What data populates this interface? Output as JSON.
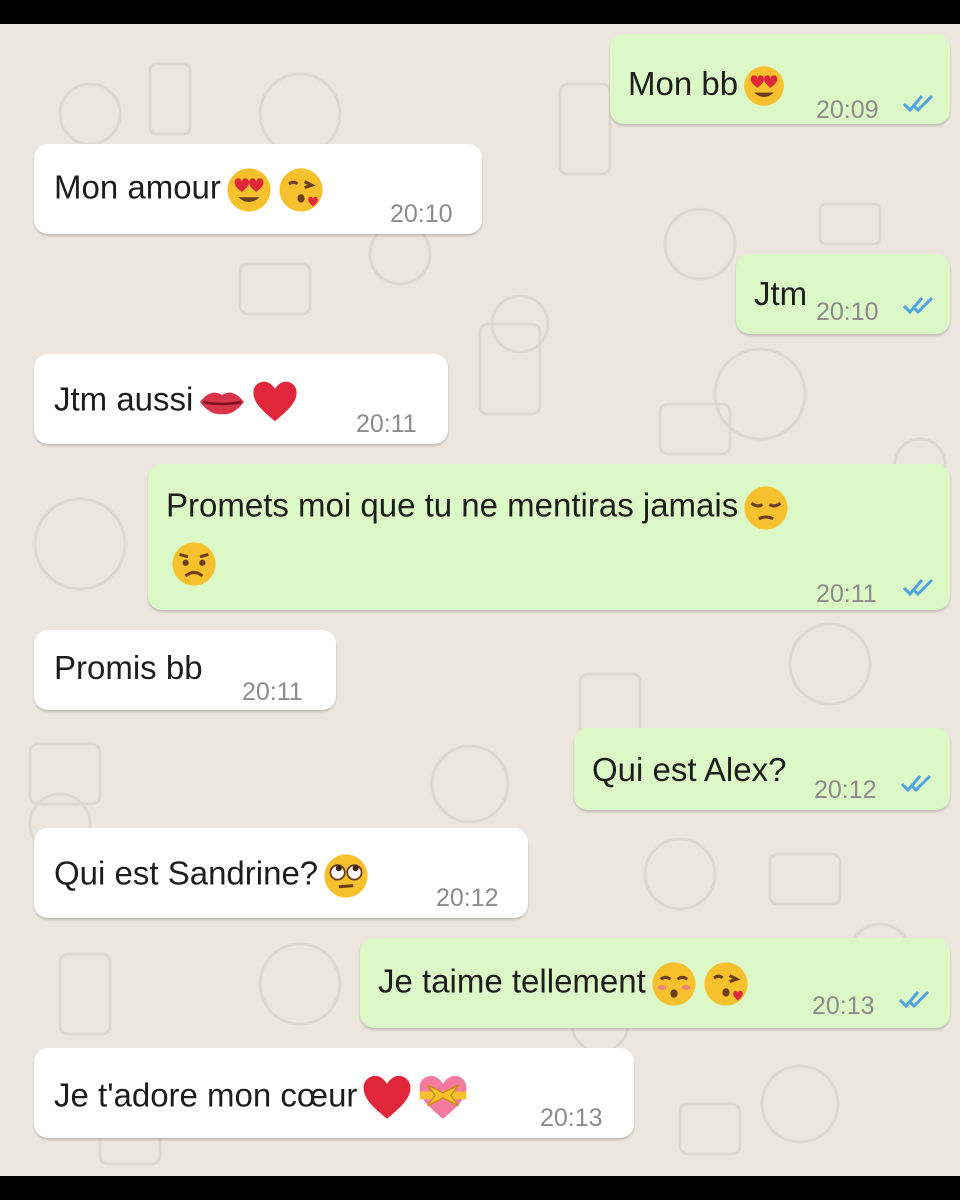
{
  "messages": [
    {
      "direction": "outgoing",
      "text": "Mon bb",
      "time": "20:09",
      "emojis": [
        "heart-eyes-face-icon"
      ],
      "read": true
    },
    {
      "direction": "incoming",
      "text": "Mon amour",
      "time": "20:10",
      "emojis": [
        "heart-eyes-face-icon",
        "face-blowing-kiss-icon"
      ]
    },
    {
      "direction": "outgoing",
      "text": "Jtm",
      "time": "20:10",
      "emojis": [],
      "read": true
    },
    {
      "direction": "incoming",
      "text": "Jtm aussi",
      "time": "20:11",
      "emojis": [
        "lips-icon",
        "red-heart-icon"
      ]
    },
    {
      "direction": "outgoing",
      "text": "Promets moi que tu ne mentiras jamais",
      "time": "20:11",
      "emojis": [
        "pensive-face-icon",
        "worried-face-icon"
      ],
      "read": true
    },
    {
      "direction": "incoming",
      "text": "Promis bb",
      "time": "20:11",
      "emojis": []
    },
    {
      "direction": "outgoing",
      "text": "Qui est Alex?",
      "time": "20:12",
      "emojis": [],
      "read": true
    },
    {
      "direction": "incoming",
      "text": "Qui est Sandrine?",
      "time": "20:12",
      "emojis": [
        "face-rolling-eyes-icon"
      ]
    },
    {
      "direction": "outgoing",
      "text": "Je taime tellement",
      "time": "20:13",
      "emojis": [
        "kissing-face-closed-eyes-icon",
        "face-blowing-kiss-icon"
      ],
      "read": true
    },
    {
      "direction": "incoming",
      "text": "Je t'adore mon cœur",
      "time": "20:13",
      "emojis": [
        "red-heart-icon",
        "heart-with-ribbon-icon"
      ]
    }
  ],
  "colors": {
    "incoming_bubble": "#ffffff",
    "outgoing_bubble": "#dcf8c6",
    "read_ticks": "#4fa4e0",
    "wallpaper": "#ece6de"
  }
}
